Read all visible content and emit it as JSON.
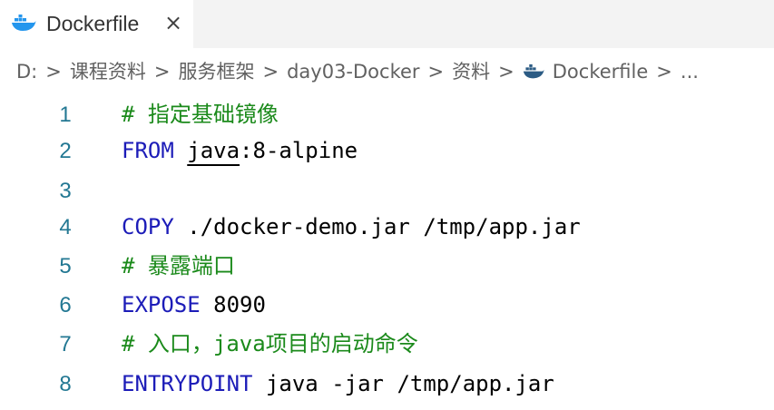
{
  "tab": {
    "label": "Dockerfile",
    "close_glyph": "×",
    "icon": "docker-whale-icon"
  },
  "breadcrumb": {
    "items": [
      "D:",
      "课程资料",
      "服务框架",
      "day03-Docker",
      "资料",
      "Dockerfile",
      "..."
    ],
    "separator": ">"
  },
  "editor": {
    "lines": [
      {
        "num": "1",
        "tokens": [
          {
            "t": "# 指定基础镜像",
            "c": "cm"
          }
        ]
      },
      {
        "num": "2",
        "tokens": [
          {
            "t": "FROM",
            "c": "kw"
          },
          {
            "t": " ",
            "c": ""
          },
          {
            "t": "java",
            "c": "ul"
          },
          {
            "t": ":8-alpine",
            "c": ""
          }
        ]
      },
      {
        "num": "3",
        "tokens": []
      },
      {
        "num": "4",
        "tokens": [
          {
            "t": "COPY",
            "c": "kw"
          },
          {
            "t": " ./docker-demo.jar /tmp/app.jar",
            "c": ""
          }
        ]
      },
      {
        "num": "5",
        "tokens": [
          {
            "t": "# 暴露端口",
            "c": "cm"
          }
        ]
      },
      {
        "num": "6",
        "tokens": [
          {
            "t": "EXPOSE",
            "c": "kw"
          },
          {
            "t": " 8090",
            "c": ""
          }
        ]
      },
      {
        "num": "7",
        "tokens": [
          {
            "t": "# 入口，java项目的启动命令",
            "c": "cm"
          }
        ]
      },
      {
        "num": "8",
        "tokens": [
          {
            "t": "ENTRYPOINT",
            "c": "kw"
          },
          {
            "t": " java -jar /tmp/app.jar",
            "c": ""
          }
        ]
      }
    ]
  },
  "colors": {
    "keyword": "#1c1cb8",
    "comment": "#1b8a1b",
    "line_number": "#237893",
    "docker_blue": "#2496ed"
  }
}
